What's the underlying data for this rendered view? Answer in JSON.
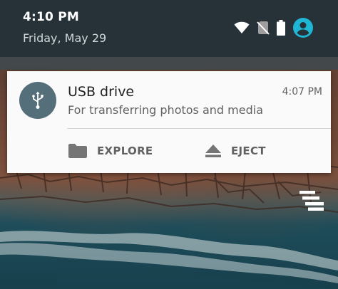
{
  "status": {
    "time": "4:10 PM",
    "date": "Friday, May 29",
    "icons": [
      "wifi-icon",
      "no-sim-icon",
      "battery-icon",
      "user-account-icon"
    ]
  },
  "notification": {
    "icon": "usb-icon",
    "title": "USB drive",
    "time": "4:07 PM",
    "text": "For transferring photos and media",
    "actions": [
      {
        "icon": "folder-icon",
        "label": "EXPLORE"
      },
      {
        "icon": "eject-icon",
        "label": "EJECT"
      }
    ]
  },
  "clear_all_icon": "clear-all-icon",
  "colors": {
    "header_bg": "#263238",
    "card_bg": "#fafafa",
    "usb_circle": "#546e7a",
    "account_accent": "#1fb6d6"
  }
}
